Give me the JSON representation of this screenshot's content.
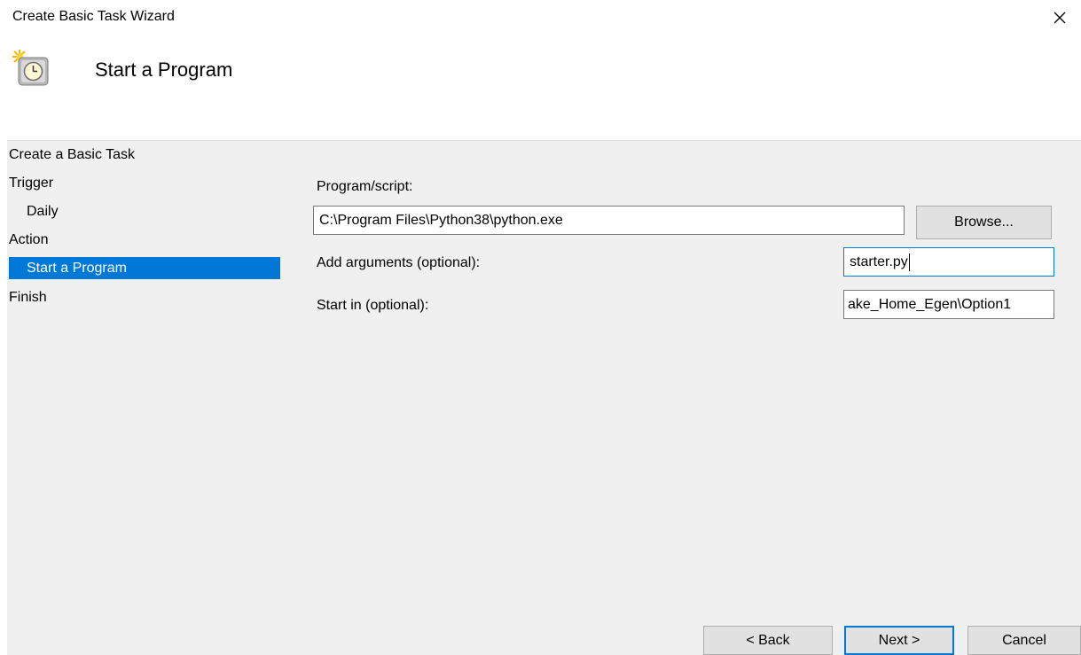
{
  "window": {
    "title": "Create Basic Task Wizard",
    "close_icon": "close-icon"
  },
  "header": {
    "icon": "task-scheduler-clock-icon",
    "title": "Start a Program"
  },
  "nav": {
    "items": [
      {
        "label": "Create a Basic Task",
        "indent": false,
        "selected": false
      },
      {
        "label": "Trigger",
        "indent": false,
        "selected": false
      },
      {
        "label": "Daily",
        "indent": true,
        "selected": false
      },
      {
        "label": "Action",
        "indent": false,
        "selected": false
      },
      {
        "label": "Start a Program",
        "indent": true,
        "selected": true
      },
      {
        "label": "Finish",
        "indent": false,
        "selected": false
      }
    ]
  },
  "form": {
    "program_label": "Program/script:",
    "program_value": "C:\\Program Files\\Python38\\python.exe",
    "browse_label": "Browse...",
    "arguments_label": "Add arguments (optional):",
    "arguments_value": "starter.py",
    "start_in_label": "Start in (optional):",
    "start_in_value": "ake_Home_Egen\\Option1"
  },
  "buttons": {
    "back": "< Back",
    "next": "Next >",
    "cancel": "Cancel"
  },
  "colors": {
    "accent": "#0078d7",
    "panel_background": "#f0f0f0"
  }
}
